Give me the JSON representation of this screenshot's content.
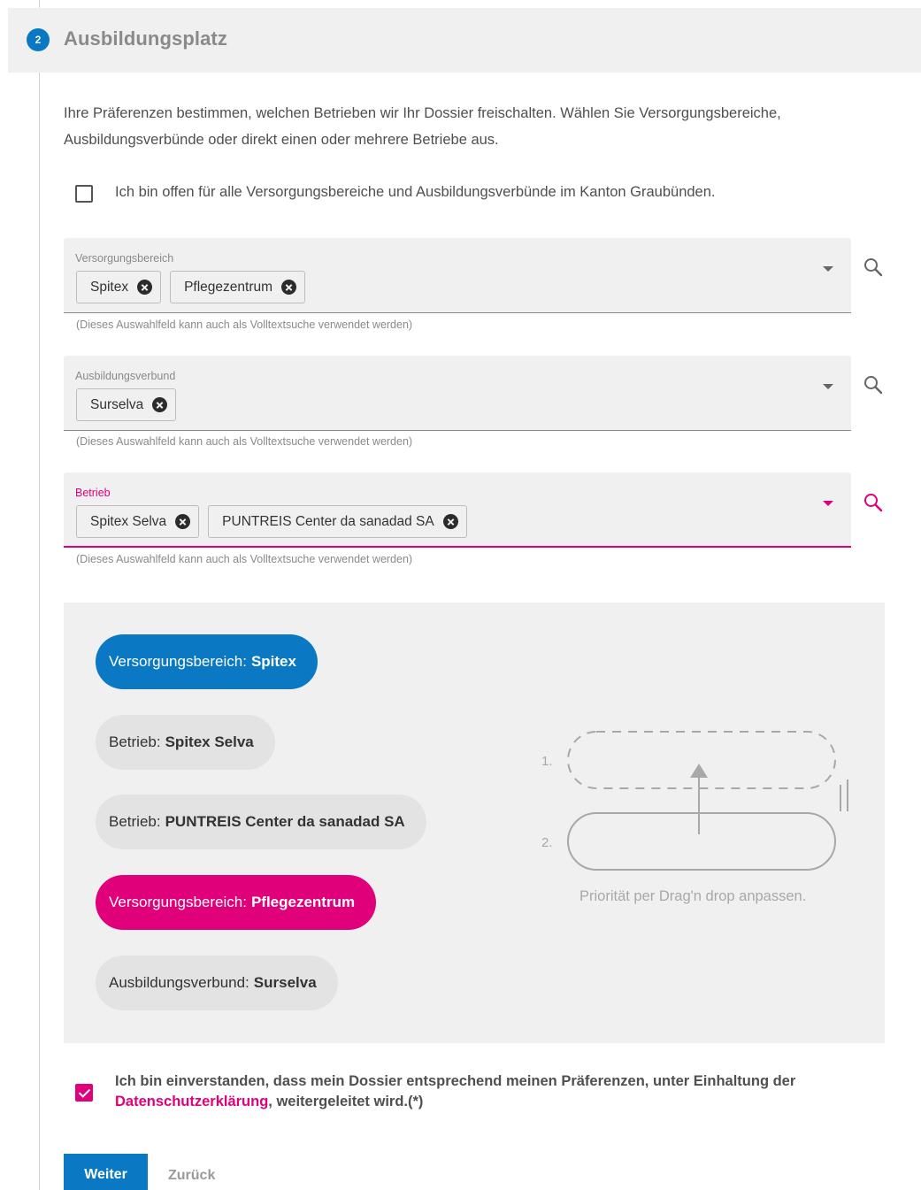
{
  "step": {
    "number": "2",
    "title": "Ausbildungsplatz"
  },
  "intro_text": "Ihre Präferenzen bestimmen, welchen Betrieben wir Ihr Dossier freischalten. Wählen Sie Versorgungsbereiche, Ausbildungsverbünde oder direkt einen oder mehrere Betriebe aus.",
  "open_checkbox": {
    "label": "Ich bin offen für alle Versorgungsbereiche und Ausbildungsverbünde im Kanton Graubünden.",
    "checked": false
  },
  "fields": [
    {
      "label": "Versorgungsbereich",
      "chips": [
        "Spitex",
        "Pflegezentrum"
      ],
      "hint": "(Dieses Auswahlfeld kann auch als Volltextsuche verwendet werden)"
    },
    {
      "label": "Ausbildungsverbund",
      "chips": [
        "Surselva"
      ],
      "hint": "(Dieses Auswahlfeld kann auch als Volltextsuche verwendet werden)"
    },
    {
      "label": "Betrieb",
      "chips": [
        "Spitex Selva",
        "PUNTREIS Center da sanadad SA"
      ],
      "hint": "(Dieses Auswahlfeld kann auch als Volltextsuche verwendet werden)"
    }
  ],
  "priority_items": [
    {
      "prefix": "Versorgungsbereich:",
      "value": "Spitex",
      "color": "#0a78c2"
    },
    {
      "prefix": "Betrieb:",
      "value": "Spitex Selva",
      "color": "#e3e3e3"
    },
    {
      "prefix": "Betrieb:",
      "value": "PUNTREIS Center da sanadad SA",
      "color": "#e3e3e3"
    },
    {
      "prefix": "Versorgungsbereich:",
      "value": "Pflegezentrum",
      "color": "#e0007a"
    },
    {
      "prefix": "Ausbildungsverbund:",
      "value": "Surselva",
      "color": "#e3e3e3"
    }
  ],
  "illustration": {
    "num1": "1.",
    "num2": "2.",
    "caption": "Priorität per Drag'n drop anpassen."
  },
  "consent": {
    "text_before": "Ich bin einverstanden, dass mein Dossier entsprechend meinen Präferenzen, unter Einhaltung der ",
    "link": "Datenschutzerklärung",
    "text_after": ", weitergeleitet wird.(*)",
    "checked": true
  },
  "buttons": {
    "next": "Weiter",
    "back": "Zurück"
  },
  "colors": {
    "primary": "#0a78c2",
    "accent": "#e0007a"
  }
}
